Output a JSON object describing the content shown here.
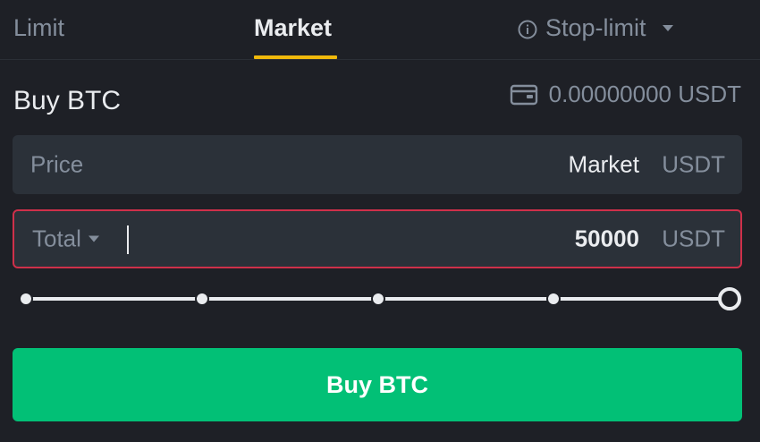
{
  "tabs": {
    "limit": "Limit",
    "market": "Market",
    "stop_limit": "Stop-limit"
  },
  "order": {
    "title": "Buy BTC",
    "balance": "0.00000000 USDT"
  },
  "price_field": {
    "label": "Price",
    "value": "Market",
    "unit": "USDT"
  },
  "total_field": {
    "label": "Total",
    "value": "50000",
    "unit": "USDT"
  },
  "slider": {
    "stops": [
      0,
      25,
      50,
      75,
      100
    ],
    "value_percent": 100
  },
  "buy_button": {
    "label": "Buy BTC"
  },
  "colors": {
    "accent": "#f0b90b",
    "buy": "#02c076",
    "error_border": "#cf304a",
    "background": "#1e2026",
    "field": "#2b3139"
  },
  "icons": {
    "stop_limit_info": "info-icon",
    "balance": "wallet-icon",
    "dropdown": "caret-down-icon"
  }
}
